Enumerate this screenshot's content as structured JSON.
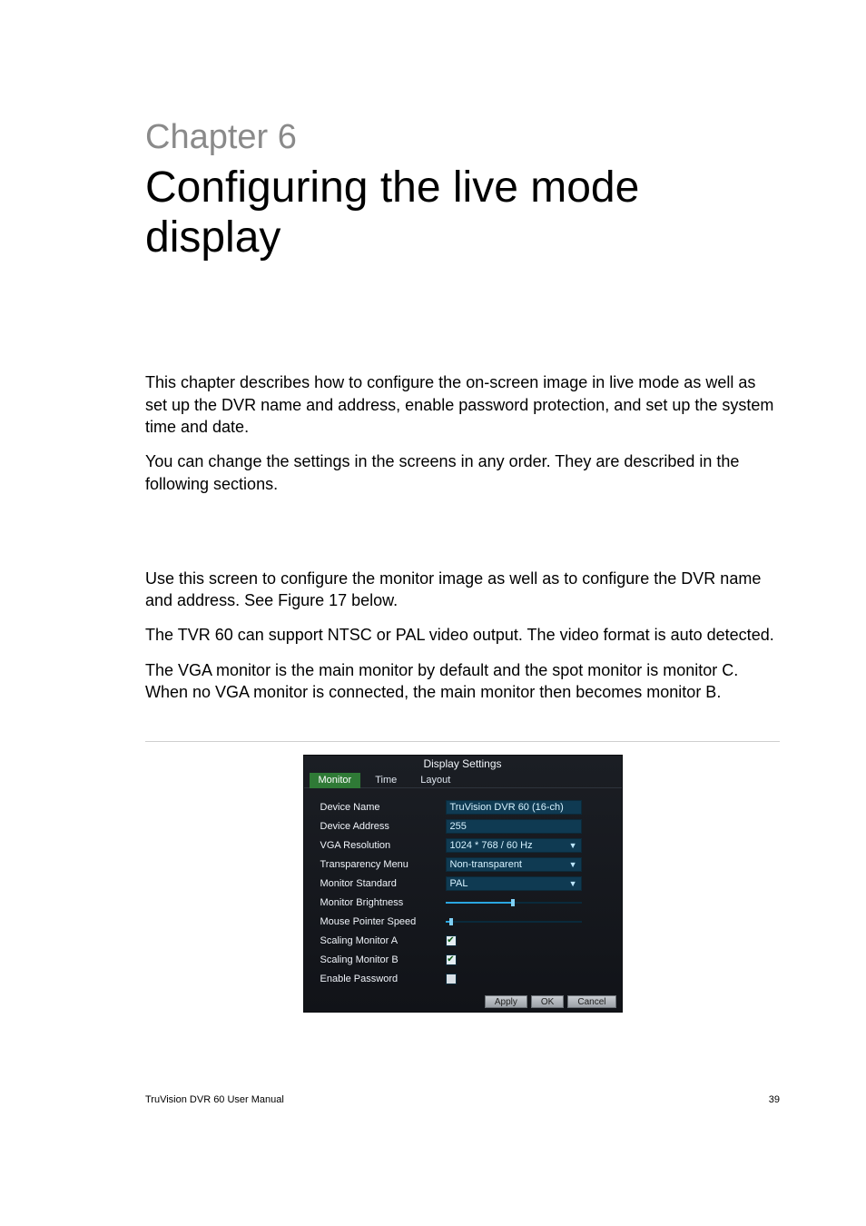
{
  "chapter": {
    "label": "Chapter 6",
    "title": "Configuring the live mode display"
  },
  "paragraphs": {
    "p1": "This chapter describes how to configure the on-screen image in live mode as well as set up the DVR name and address, enable password protection, and set up the system time and date.",
    "p2": "You can change the settings in the screens in any order. They are described in the following sections.",
    "p3": "Use this screen to configure the monitor image as well as to configure the DVR name and address. See Figure 17 below.",
    "p4": "The TVR 60 can support NTSC or PAL video output. The video format is auto detected.",
    "p5": "The VGA monitor is the main monitor by default and the spot monitor is monitor C. When no VGA monitor is connected, the main monitor then becomes monitor B."
  },
  "screenshot": {
    "title": "Display Settings",
    "tabs": {
      "t1": "Monitor",
      "t2": "Time",
      "t3": "Layout"
    },
    "rows": {
      "device_name": {
        "label": "Device Name",
        "value": "TruVision DVR 60 (16-ch)"
      },
      "device_address": {
        "label": "Device Address",
        "value": "255"
      },
      "vga_resolution": {
        "label": "VGA Resolution",
        "value": "1024 * 768 / 60 Hz"
      },
      "transparency": {
        "label": "Transparency Menu",
        "value": "Non-transparent"
      },
      "monitor_standard": {
        "label": "Monitor Standard",
        "value": "PAL"
      },
      "monitor_brightness": {
        "label": "Monitor Brightness"
      },
      "mouse_pointer_speed": {
        "label": "Mouse Pointer Speed"
      },
      "scaling_a": {
        "label": "Scaling Monitor A"
      },
      "scaling_b": {
        "label": "Scaling Monitor B"
      },
      "enable_password": {
        "label": "Enable Password"
      }
    },
    "buttons": {
      "apply": "Apply",
      "ok": "OK",
      "cancel": "Cancel"
    }
  },
  "footer": {
    "left": "TruVision DVR 60 User Manual",
    "right": "39"
  }
}
